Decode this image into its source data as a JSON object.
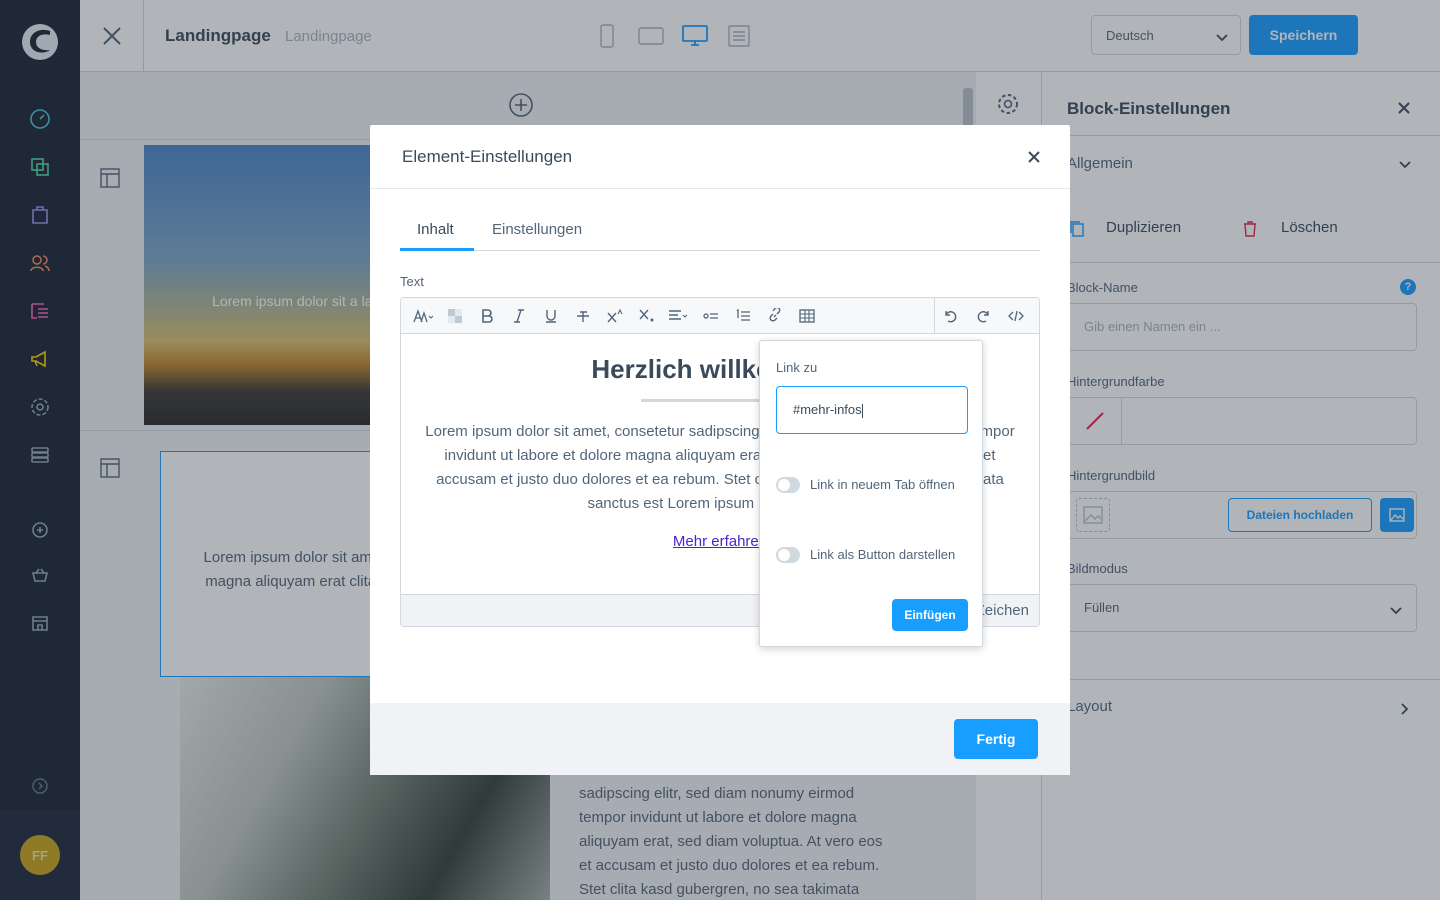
{
  "app": {
    "page_title": "Landingpage",
    "page_subtitle": "Landingpage",
    "language": "Deutsch",
    "save_label": "Speichern",
    "avatar_initials": "FF"
  },
  "canvas": {
    "image1_text": "Lorem ipsum dolor sit a labo",
    "selected_block_text": "Lorem ipsum dolor sit amet, dolore magna aliquyam erat clita kasd gu",
    "plant_text": "sadipscing elitr, sed diam nonumy eirmod tempor invidunt ut labore et dolore magna aliquyam erat, sed diam voluptua. At vero eos et accusam et justo duo dolores et ea rebum. Stet clita kasd gubergren, no sea takimata"
  },
  "panel": {
    "title": "Block-Einstellungen",
    "general_label": "Allgemein",
    "duplicate_label": "Duplizieren",
    "delete_label": "Löschen",
    "block_name_label": "Block-Name",
    "block_name_placeholder": "Gib einen Namen ein ...",
    "bg_color_label": "Hintergrundfarbe",
    "bg_image_label": "Hintergrundbild",
    "upload_label": "Dateien hochladen",
    "image_mode_label": "Bildmodus",
    "image_mode_value": "Füllen",
    "layout_label": "Layout"
  },
  "modal": {
    "title": "Element-Einstellungen",
    "tabs": [
      "Inhalt",
      "Einstellungen"
    ],
    "text_label": "Text",
    "heading": "Herzlich willkommen",
    "paragraph": "Lorem ipsum dolor sit amet, consetetur sadipscing elitr, sed diam nonumy eirmod tempor invidunt ut labore et dolore magna aliquyam erat, sed diam voluptua. At vero eos et accusam et justo duo dolores et ea rebum. Stet clita kasd gubergren, no sea takimata sanctus est Lorem ipsum dolor sit amet.",
    "link_text": "Mehr erfahren",
    "status_text": "Zeichen",
    "done_label": "Fertig"
  },
  "popover": {
    "label": "Link zu",
    "value": "#mehr-infos",
    "new_tab_label": "Link in neuem Tab öffnen",
    "button_label": "Link als Button darstellen",
    "insert_label": "Einfügen"
  },
  "colors": {
    "accent": "#189eff",
    "sidebar": "#1a2433",
    "link": "#4a22d0"
  }
}
